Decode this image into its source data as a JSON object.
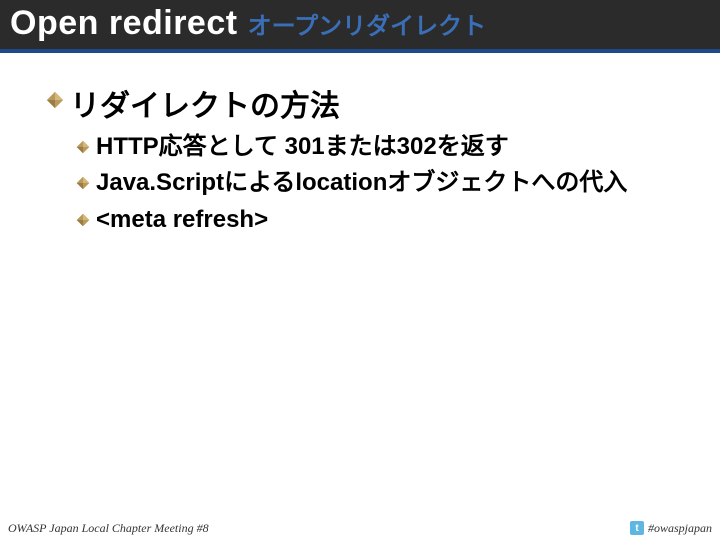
{
  "header": {
    "title_en": "Open redirect",
    "title_ja": "オープンリダイレクト"
  },
  "content": {
    "heading": "リダイレクトの方法",
    "bullets": [
      "HTTP応答として 301または302を返す",
      "Java.Scriptによるlocationオブジェクトへの代入",
      "<meta refresh>"
    ]
  },
  "footer": {
    "left": "OWASP Japan Local Chapter Meeting #8",
    "hashtag": "#owaspjapan",
    "twitter_glyph": "t"
  },
  "colors": {
    "diamond_fill": "#b89a5a",
    "diamond_stroke": "#7a5c2e"
  }
}
